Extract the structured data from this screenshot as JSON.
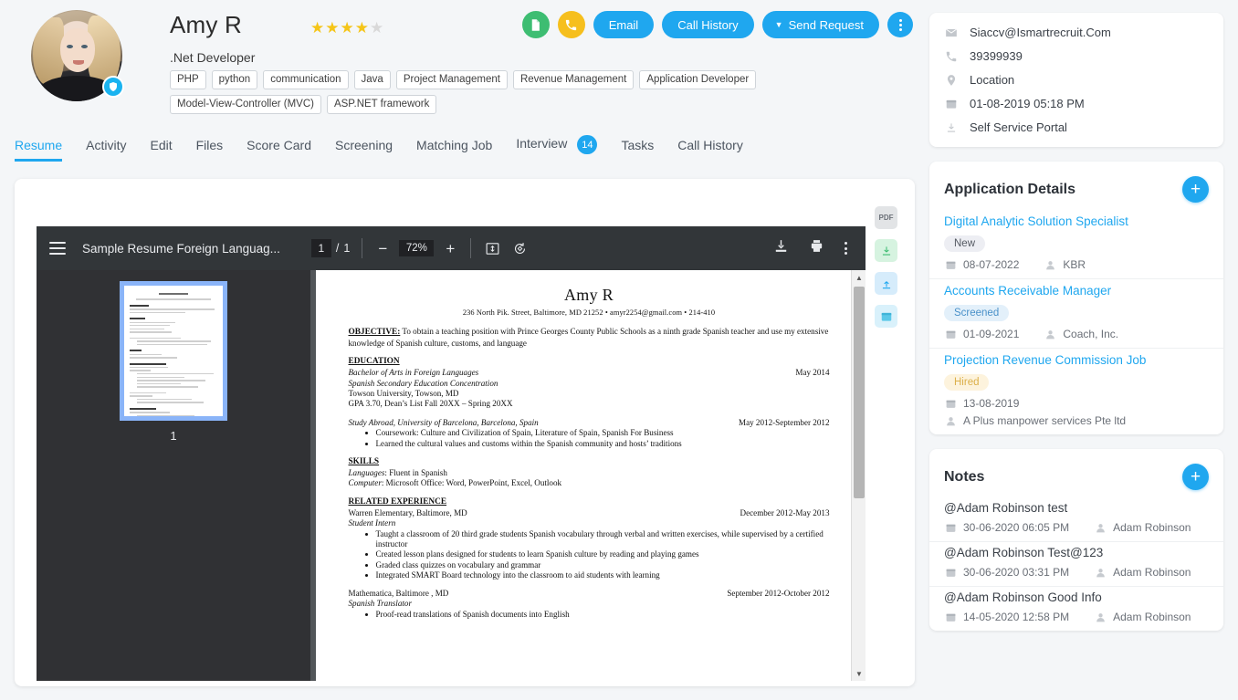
{
  "candidate": {
    "name": "Amy R",
    "title": ".Net Developer",
    "rating": 4,
    "rating_max": 5,
    "tags": [
      "PHP",
      "python",
      "communication",
      "Java",
      "Project Management",
      "Revenue Management",
      "Application Developer",
      "Model-View-Controller (MVC)",
      "ASP.NET framework"
    ]
  },
  "header_actions": {
    "resume_icon": "document-icon",
    "call_icon": "phone-icon",
    "email_label": "Email",
    "call_history_label": "Call History",
    "send_request_label": "Send Request",
    "more_icon": "kebab-menu-icon",
    "accent": "#1fa7ef",
    "green": "#3dbd72",
    "yellow": "#f6bf1d"
  },
  "tabs": [
    {
      "label": "Resume",
      "active": true
    },
    {
      "label": "Activity",
      "active": false
    },
    {
      "label": "Edit",
      "active": false
    },
    {
      "label": "Files",
      "active": false
    },
    {
      "label": "Score Card",
      "active": false
    },
    {
      "label": "Screening",
      "active": false
    },
    {
      "label": "Matching Job",
      "active": false
    },
    {
      "label": "Interview",
      "active": false,
      "badge": "14"
    },
    {
      "label": "Tasks",
      "active": false
    },
    {
      "label": "Call History",
      "active": false
    }
  ],
  "pdf_viewer": {
    "doc_title": "Sample Resume Foreign Languag...",
    "page_current": "1",
    "page_sep": "/",
    "page_total": "1",
    "zoom_out": "−",
    "zoom_level": "72%",
    "zoom_in": "+",
    "fit_icon": "fit-page-icon",
    "rotate_icon": "rotate-icon",
    "download_icon": "download-icon",
    "print_icon": "print-icon",
    "more_icon": "kebab-menu-icon",
    "thumbnail_page_label": "1"
  },
  "resume_doc": {
    "name": "Amy R",
    "contact": "236  North Pik. Street, Baltimore, MD 21252 • amyr2254@gmail.com • 214-410",
    "objective_label": "OBJECTIVE:",
    "objective_text": " To obtain a teaching position with Prince Georges County Public Schools as a ninth grade Spanish teacher and use my extensive knowledge of Spanish culture, customs, and language",
    "education_label": "EDUCATION",
    "edu_degree": "Bachelor of Arts in Foreign Languages",
    "edu_date": "May 2014",
    "edu_concentration": "Spanish Secondary Education Concentration",
    "edu_school": "Towson University, Towson, MD",
    "edu_gpa": "GPA 3.70, Dean’s List Fall 20XX – Spring 20XX",
    "abroad_title": "Study Abroad, University of Barcelona, Barcelona, Spain",
    "abroad_date": "May 2012-September 2012",
    "abroad_bullets": [
      "Coursework: Culture and Civilization of Spain, Literature of Spain, Spanish For Business",
      "Learned the cultural values and customs within the Spanish community and hosts’ traditions"
    ],
    "skills_label": "SKILLS",
    "skills_lang_label": "Languages",
    "skills_lang_value": ": Fluent in Spanish",
    "skills_comp_label": "Computer",
    "skills_comp_value": ": Microsoft Office: Word, PowerPoint, Excel, Outlook",
    "experience_label": "RELATED EXPERIENCE",
    "exp1_org": "Warren Elementary, Baltimore, MD",
    "exp1_date": "December 2012-May 2013",
    "exp1_role": "Student Intern",
    "exp1_bullets": [
      "Taught a classroom of 20 third grade students Spanish vocabulary through verbal and written exercises, while supervised by a certified instructor",
      "Created lesson plans designed for students to learn Spanish culture by reading and playing games",
      "Graded class quizzes on vocabulary and grammar",
      "Integrated SMART Board technology into the classroom to aid students with learning"
    ],
    "exp2_org": "Mathematica, Baltimore , MD",
    "exp2_date": "September 2012-October 2012",
    "exp2_role": "Spanish Translator",
    "exp2_bullets": [
      "Proof-read translations of Spanish documents into English"
    ]
  },
  "quick_actions": [
    {
      "name": "pdf-export-icon",
      "label": "PDF"
    },
    {
      "name": "download-icon",
      "label": ""
    },
    {
      "name": "upload-icon",
      "label": ""
    },
    {
      "name": "calendar-icon",
      "label": ""
    }
  ],
  "contact": {
    "email": "Siaccv@Ismartrecruit.Com",
    "phone": "39399939",
    "location": "Location",
    "date": "01-08-2019 05:18 PM",
    "portal": "Self Service Portal"
  },
  "application_details": {
    "title": "Application Details",
    "add_label": "+",
    "items": [
      {
        "job": "Digital Analytic Solution Specialist",
        "status": "New",
        "status_kind": "new",
        "date": "08-07-2022",
        "company": "KBR",
        "stacked": false
      },
      {
        "job": "Accounts Receivable Manager",
        "status": "Screened",
        "status_kind": "screened",
        "date": "01-09-2021",
        "company": "Coach, Inc.",
        "stacked": false
      },
      {
        "job": "Projection Revenue Commission Job",
        "status": "Hired",
        "status_kind": "hired",
        "date": "13-08-2019",
        "company": "A Plus manpower services Pte ltd",
        "stacked": true
      }
    ]
  },
  "notes": {
    "title": "Notes",
    "add_label": "+",
    "items": [
      {
        "text": "@Adam Robinson test",
        "date": "30-06-2020 06:05 PM",
        "author": "Adam Robinson"
      },
      {
        "text": "@Adam Robinson Test@123",
        "date": "30-06-2020 03:31 PM",
        "author": "Adam Robinson"
      },
      {
        "text": "@Adam Robinson Good Info",
        "date": "14-05-2020 12:58 PM",
        "author": "Adam Robinson"
      }
    ]
  }
}
